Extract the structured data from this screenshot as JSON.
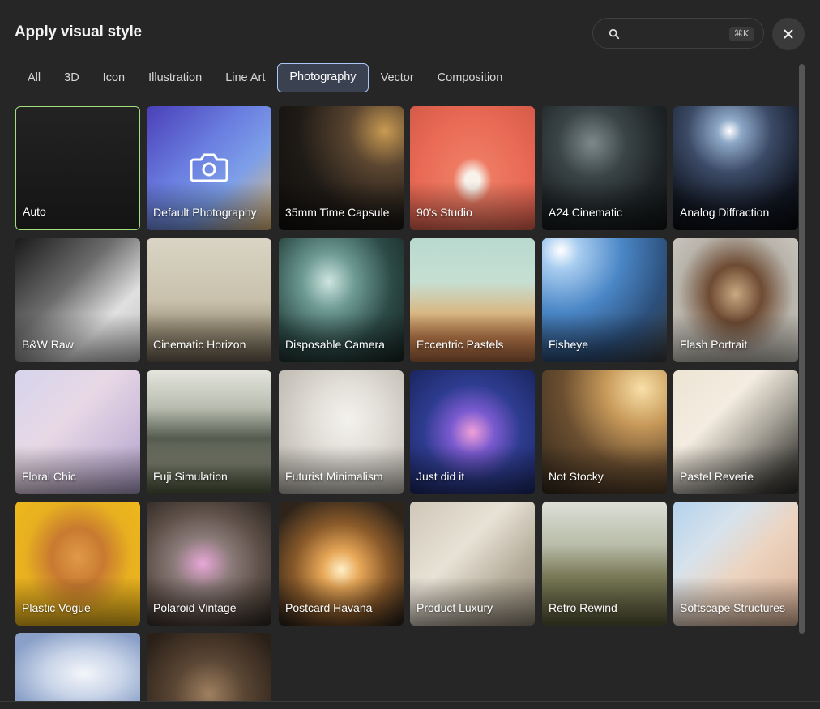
{
  "header": {
    "title": "Apply visual style"
  },
  "search": {
    "placeholder": "",
    "value": "",
    "shortcut": "⌘K"
  },
  "tabs": [
    {
      "label": "All",
      "active": false
    },
    {
      "label": "3D",
      "active": false
    },
    {
      "label": "Icon",
      "active": false
    },
    {
      "label": "Illustration",
      "active": false
    },
    {
      "label": "Line Art",
      "active": false
    },
    {
      "label": "Photography",
      "active": true
    },
    {
      "label": "Vector",
      "active": false
    },
    {
      "label": "Composition",
      "active": false
    }
  ],
  "styles": [
    {
      "label": "Auto",
      "selected": true,
      "icon": ""
    },
    {
      "label": "Default Photography",
      "selected": false,
      "icon": "camera-icon"
    },
    {
      "label": "35mm Time Capsule"
    },
    {
      "label": "90's Studio"
    },
    {
      "label": "A24 Cinematic"
    },
    {
      "label": "Analog Diffraction"
    },
    {
      "label": "B&W Raw"
    },
    {
      "label": "Cinematic Horizon"
    },
    {
      "label": "Disposable Camera"
    },
    {
      "label": "Eccentric Pastels"
    },
    {
      "label": "Fisheye"
    },
    {
      "label": "Flash Portrait"
    },
    {
      "label": "Floral Chic"
    },
    {
      "label": "Fuji Simulation"
    },
    {
      "label": "Futurist Minimalism"
    },
    {
      "label": "Just did it"
    },
    {
      "label": "Not Stocky"
    },
    {
      "label": "Pastel Reverie"
    },
    {
      "label": "Plastic Vogue"
    },
    {
      "label": "Polaroid Vintage"
    },
    {
      "label": "Postcard Havana"
    },
    {
      "label": "Product Luxury"
    },
    {
      "label": "Retro Rewind"
    },
    {
      "label": "Softscape Structures"
    },
    {
      "label": ""
    },
    {
      "label": ""
    }
  ],
  "colors": {
    "accent_selected": "#a4e07a",
    "tab_active_border": "#a9c6f5",
    "background": "#262626"
  }
}
